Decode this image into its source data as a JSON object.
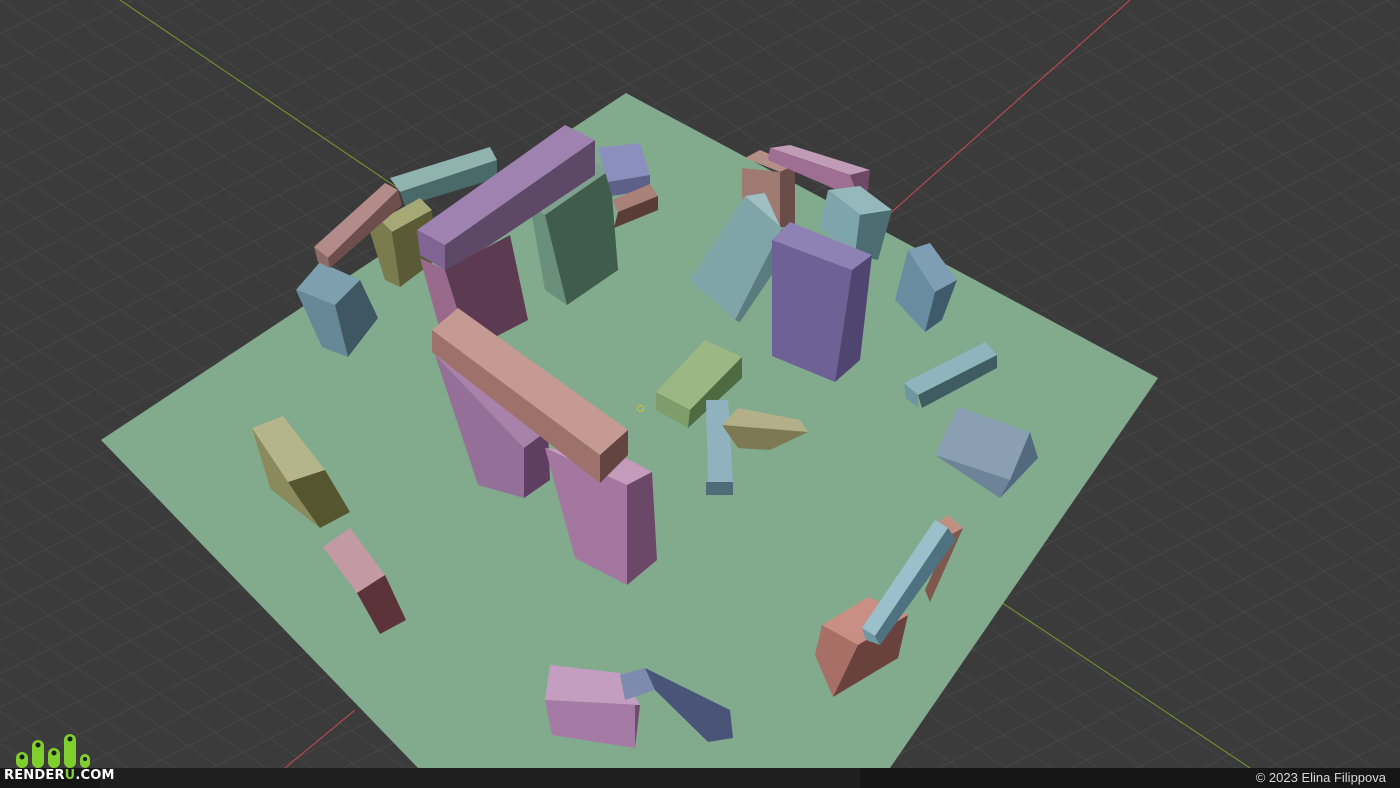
{
  "viewport": {
    "name": "3D Viewport",
    "ground_color": "#82ab8e",
    "grid_bg": "#3b3b3b",
    "grid_line": "#4a4a4a",
    "axis_x_color": "#c84a55",
    "axis_y_color": "#7e9a2a"
  },
  "brand": {
    "logo_prefix": "RENDER",
    "logo_u": "U",
    "logo_suffix": ".COM",
    "logo_icon": "renderu-logo-icon",
    "accent": "#7fcf2e"
  },
  "footer": {
    "credit": "© 2023 Elina Filippova"
  }
}
